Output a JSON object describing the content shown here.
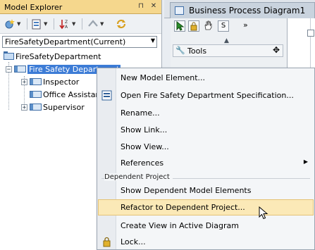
{
  "explorer": {
    "title": "Model Explorer",
    "pin_glyph": "⊓",
    "close_glyph": "✕",
    "project_select": "FireSafetyDepartment(Current)",
    "toolbar_icons": [
      "new-element-icon",
      "package-icon",
      "sort-za-icon",
      "up-icon",
      "refresh-icon"
    ],
    "tree": {
      "root": "FireSafetyDepartment",
      "model": "Fire Safety Department",
      "children": [
        "Inspector",
        "Office Assistant",
        "Supervisor"
      ]
    }
  },
  "diagram": {
    "tab_title": "Business Process Diagram1",
    "palette_s": "S",
    "palette_chevron": "»",
    "tools_label": "Tools"
  },
  "context_menu": {
    "items": [
      {
        "label": "New Model Element..."
      },
      {
        "label": "Open Fire Safety Department Specification..."
      },
      {
        "label": "Rename..."
      },
      {
        "label": "Show Link..."
      },
      {
        "label": "Show View..."
      },
      {
        "label": "References"
      }
    ],
    "group_label": "Dependent Project",
    "group_items": [
      {
        "label": "Show Dependent Model Elements"
      },
      {
        "label": "Refactor to Dependent Project..."
      },
      {
        "label": "Create View in Active Diagram"
      },
      {
        "label": "Lock..."
      }
    ],
    "submenu_arrow": "▶"
  },
  "colors": {
    "title_bar": "#f5d78d",
    "selection": "#3d7cd6",
    "menu_highlight": "#fbe9b7"
  }
}
